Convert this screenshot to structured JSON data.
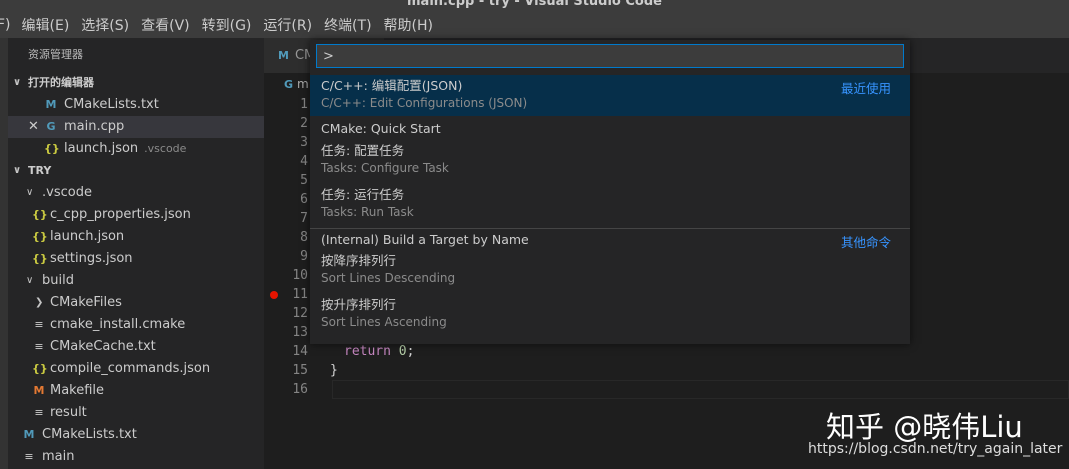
{
  "window": {
    "title": "main.cpp - try - Visual Studio Code"
  },
  "menubar": {
    "items": [
      "F)",
      "编辑(E)",
      "选择(S)",
      "查看(V)",
      "转到(G)",
      "运行(R)",
      "终端(T)",
      "帮助(H)"
    ]
  },
  "sidebar": {
    "title": "资源管理器",
    "open_editors": {
      "header": "打开的编辑器",
      "items": [
        {
          "icon": "M",
          "label": "CMakeLists.txt",
          "desc": ""
        },
        {
          "icon": "G",
          "label": "main.cpp",
          "desc": ""
        },
        {
          "icon": "{}",
          "label": "launch.json",
          "desc": ".vscode"
        }
      ]
    },
    "folder": {
      "header": "TRY",
      "items": [
        {
          "label": ".vscode",
          "icon": ""
        },
        {
          "label": "c_cpp_properties.json",
          "icon": "{}"
        },
        {
          "label": "launch.json",
          "icon": "{}"
        },
        {
          "label": "settings.json",
          "icon": "{}"
        },
        {
          "label": "build",
          "icon": ""
        },
        {
          "label": "CMakeFiles",
          "icon": ""
        },
        {
          "label": "cmake_install.cmake",
          "icon": "≡"
        },
        {
          "label": "CMakeCache.txt",
          "icon": "≡"
        },
        {
          "label": "compile_commands.json",
          "icon": "{}"
        },
        {
          "label": "Makefile",
          "icon": "M"
        },
        {
          "label": "result",
          "icon": "≡"
        },
        {
          "label": "CMakeLists.txt",
          "icon": "M"
        },
        {
          "label": "main",
          "icon": "≡"
        }
      ]
    }
  },
  "editor": {
    "tab_label": "CM",
    "breadcrumb": "m",
    "line_numbers": [
      "1",
      "2",
      "3",
      "4",
      "5",
      "6",
      "7",
      "8",
      "9",
      "10",
      "11",
      "12",
      "13",
      "14",
      "15",
      "16"
    ],
    "code": {
      "return_kw": "return",
      "return_val": "0",
      "return_end": ";",
      "close_brace": "}"
    }
  },
  "palette": {
    "input_value": ">",
    "items": [
      {
        "title": "C/C++: 编辑配置(JSON)",
        "subtitle": "C/C++: Edit Configurations (JSON)",
        "tag": "最近使用"
      },
      {
        "title": "CMake: Quick Start",
        "subtitle": "",
        "tag": ""
      },
      {
        "title": "任务: 配置任务",
        "subtitle": "Tasks: Configure Task",
        "tag": ""
      },
      {
        "title": "任务: 运行任务",
        "subtitle": "Tasks: Run Task",
        "tag": ""
      },
      {
        "title": "(Internal) Build a Target by Name",
        "subtitle": "",
        "tag": "其他命令"
      },
      {
        "title": "按降序排列行",
        "subtitle": "Sort Lines Descending",
        "tag": ""
      },
      {
        "title": "按升序排列行",
        "subtitle": "Sort Lines Ascending",
        "tag": ""
      }
    ]
  },
  "watermark": {
    "main": "知乎 @晓伟Liu",
    "url": "https://blog.csdn.net/try_again_later"
  }
}
